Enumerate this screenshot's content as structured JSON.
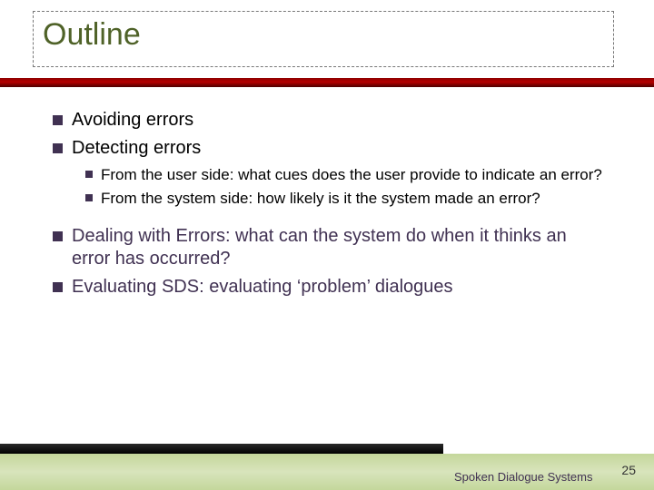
{
  "title": "Outline",
  "bullets": {
    "items": [
      {
        "text": "Avoiding errors",
        "purple": false
      },
      {
        "text": "Detecting errors",
        "purple": false
      }
    ],
    "sub": [
      {
        "text": "From the user side:  what cues does the user provide to indicate an error?"
      },
      {
        "text": "From the system side:  how likely is it the system made an error?"
      }
    ],
    "tail": [
      {
        "text": "Dealing with Errors:  what can the system do when it thinks an error has occurred?",
        "purple": true
      },
      {
        "text": "Evaluating SDS:  evaluating ‘problem’ dialogues",
        "purple": true
      }
    ]
  },
  "footer": {
    "label": "Spoken Dialogue Systems",
    "page": "25"
  }
}
